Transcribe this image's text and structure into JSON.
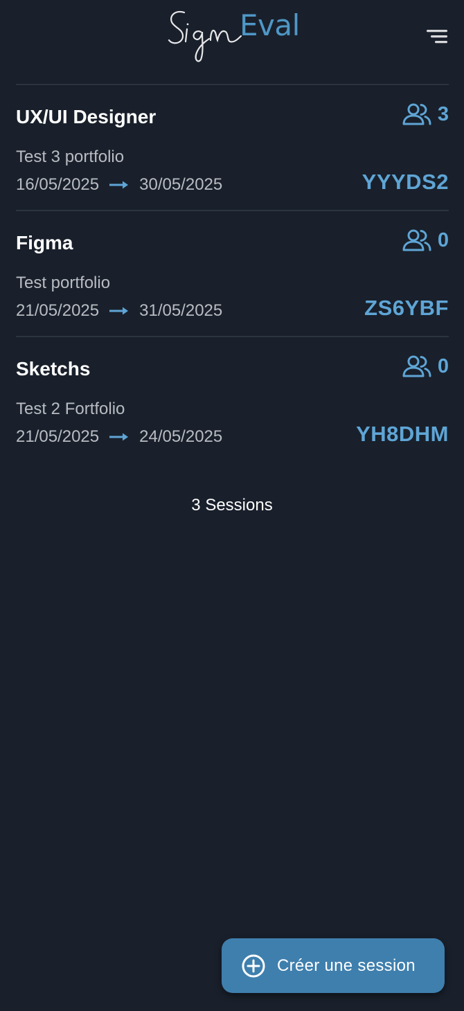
{
  "header": {
    "logo_script": "Sign",
    "logo_text": "Eval",
    "menu_icon": "menu-icon"
  },
  "sessions": [
    {
      "title": "UX/UI Designer",
      "participants": "3",
      "description": "Test 3 portfolio",
      "start_date": "16/05/2025",
      "end_date": "30/05/2025",
      "code": "YYYDS2"
    },
    {
      "title": "Figma",
      "participants": "0",
      "description": "Test portfolio",
      "start_date": "21/05/2025",
      "end_date": "31/05/2025",
      "code": "ZS6YBF"
    },
    {
      "title": "Sketchs",
      "participants": "0",
      "description": "Test 2 Fortfolio",
      "start_date": "21/05/2025",
      "end_date": "24/05/2025",
      "code": "YH8DHM"
    }
  ],
  "footer": {
    "session_count": "3 Sessions"
  },
  "create_button": {
    "label": "Créer une session",
    "icon": "plus-circle-icon"
  },
  "colors": {
    "background": "#19202b",
    "accent": "#5fa5d6",
    "button": "#3f7fad",
    "muted_text": "#b9bcc2",
    "divider": "#2c3440"
  }
}
